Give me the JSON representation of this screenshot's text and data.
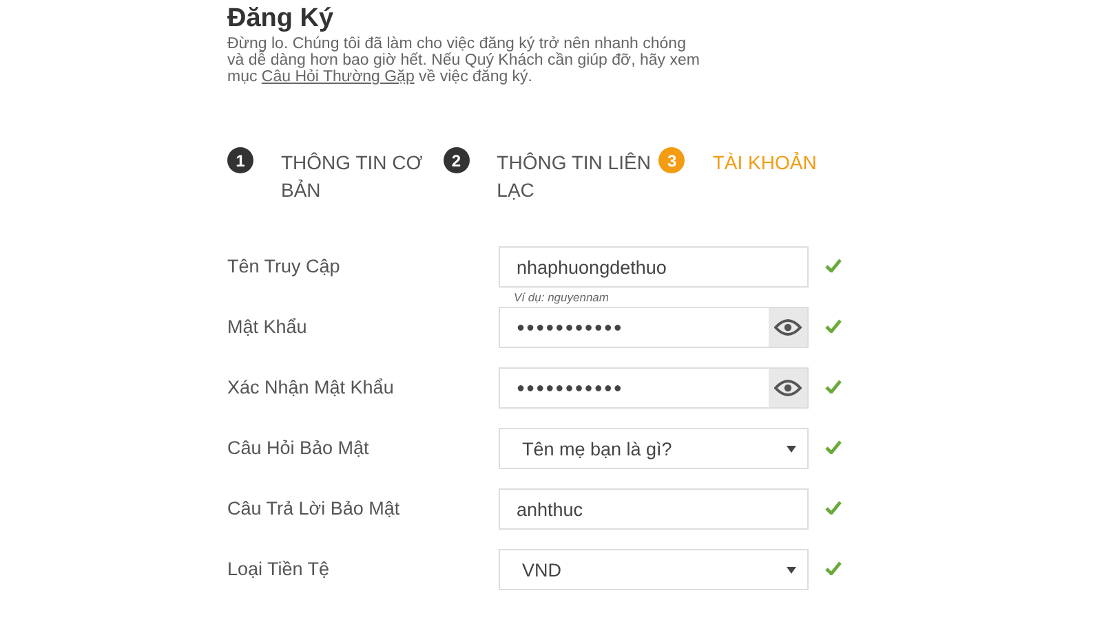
{
  "title": "Đăng Ký",
  "intro": {
    "before": "Đừng lo. Chúng tôi đã làm cho việc đăng ký trở nên nhanh chóng và dễ dàng hơn bao giờ hết. Nếu Quý Khách cần giúp đỡ, hãy xem mục ",
    "link": "Câu Hỏi Thường Gặp",
    "after": " về việc đăng ký."
  },
  "steps": [
    {
      "number": "1",
      "label": "THÔNG TIN CƠ BẢN",
      "selected": false
    },
    {
      "number": "2",
      "label": "THÔNG TIN LIÊN LẠC",
      "selected": false
    },
    {
      "number": "3",
      "label": "TÀI KHOẢN",
      "selected": true
    }
  ],
  "fields": [
    {
      "kind": "text",
      "label": "Tên Truy Cập",
      "value": "nhaphuongdethuo",
      "hint": "Ví dụ: nguyennam",
      "valid": true
    },
    {
      "kind": "password",
      "label": "Mật Khẩu",
      "value": "●●●●●●●●●●●",
      "valid": true
    },
    {
      "kind": "password",
      "label": "Xác Nhận Mật Khẩu",
      "value": "●●●●●●●●●●●",
      "valid": true
    },
    {
      "kind": "select",
      "label": "Câu Hỏi Bảo Mật",
      "value": "Tên mẹ bạn là gì?",
      "valid": true
    },
    {
      "kind": "text",
      "label": "Câu Trả Lời Bảo Mật",
      "value": "anhthuc",
      "valid": true
    },
    {
      "kind": "select",
      "label": "Loại Tiền Tệ",
      "value": "VND",
      "valid": true
    }
  ]
}
